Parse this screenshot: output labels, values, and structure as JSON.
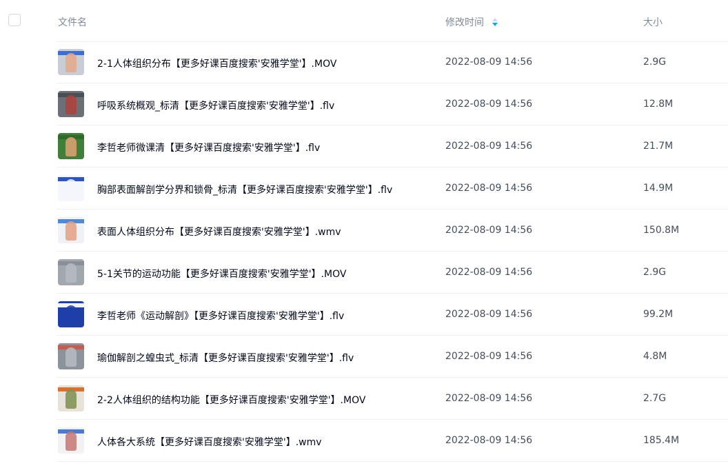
{
  "header": {
    "name_label": "文件名",
    "time_label": "修改时间",
    "size_label": "大小",
    "sort_icon": "sort-descending-icon"
  },
  "files": [
    {
      "name": "2-1人体组织分布【更多好课百度搜索'安雅学堂'】.MOV",
      "modified": "2022-08-09 14:56",
      "size": "2.9G",
      "thumb": {
        "bg": "#c9cdd6",
        "band": "#3b6fd1",
        "figure": "#e4a889"
      }
    },
    {
      "name": "呼吸系统概观_标清【更多好课百度搜索'安雅学堂'】.flv",
      "modified": "2022-08-09 14:56",
      "size": "12.8M",
      "thumb": {
        "bg": "#6b6f76",
        "band": "#4a4e55",
        "figure": "#b2413c"
      }
    },
    {
      "name": "李哲老师微课清【更多好课百度搜索'安雅学堂'】.flv",
      "modified": "2022-08-09 14:56",
      "size": "21.7M",
      "thumb": {
        "bg": "#3f7f3a",
        "band": "#2e6b2a",
        "figure": "#e2a273"
      }
    },
    {
      "name": "胸部表面解剖学分界和锁骨_标清【更多好课百度搜索'安雅学堂'】.flv",
      "modified": "2022-08-09 14:56",
      "size": "14.9M",
      "thumb": {
        "bg": "#f4f6fb",
        "band": "#2b55c7",
        "figure": "#f4f6fb"
      }
    },
    {
      "name": "表面人体组织分布【更多好课百度搜索'安雅学堂'】.wmv",
      "modified": "2022-08-09 14:56",
      "size": "150.8M",
      "thumb": {
        "bg": "#eef1f6",
        "band": "#4f8ad6",
        "figure": "#e3a07f"
      }
    },
    {
      "name": "5-1关节的运动功能【更多好课百度搜索'安雅学堂'】.MOV",
      "modified": "2022-08-09 14:56",
      "size": "2.9G",
      "thumb": {
        "bg": "#a2a7ae",
        "band": "#8b9098",
        "figure": "#b6bbc2"
      }
    },
    {
      "name": "李哲老师《运动解剖》【更多好课百度搜索'安雅学堂'】.flv",
      "modified": "2022-08-09 14:56",
      "size": "99.2M",
      "thumb": {
        "bg": "#1e3fa8",
        "band": "#f2f4f8",
        "figure": "#1e3fa8"
      }
    },
    {
      "name": "瑜伽解剖之蝗虫式_标清【更多好课百度搜索'安雅学堂'】.flv",
      "modified": "2022-08-09 14:56",
      "size": "4.8M",
      "thumb": {
        "bg": "#8d939b",
        "band": "#c95a4e",
        "figure": "#b7bcc3"
      }
    },
    {
      "name": "2-2人体组织的结构功能【更多好课百度搜索'安雅学堂'】.MOV",
      "modified": "2022-08-09 14:56",
      "size": "2.7G",
      "thumb": {
        "bg": "#e7e2da",
        "band": "#d9712e",
        "figure": "#7a8f4f"
      }
    },
    {
      "name": "人体各大系统【更多好课百度搜索'安雅学堂'】.wmv",
      "modified": "2022-08-09 14:56",
      "size": "185.4M",
      "thumb": {
        "bg": "#f2f2f4",
        "band": "#4a7bd0",
        "figure": "#c7776f"
      }
    }
  ]
}
